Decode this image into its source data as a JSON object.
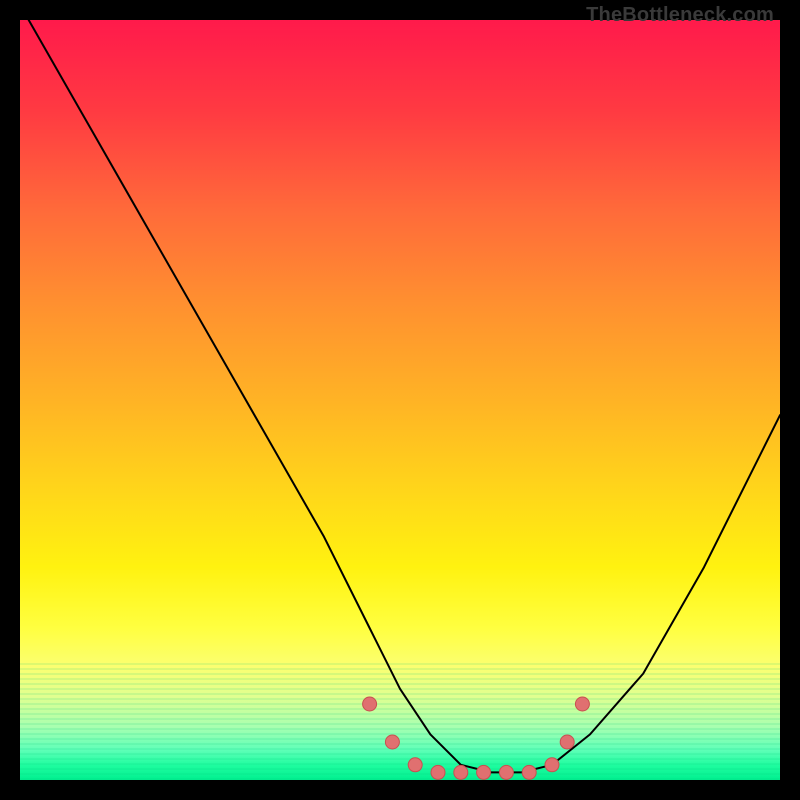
{
  "watermark": "TheBottleneck.com",
  "chart_data": {
    "type": "line",
    "title": "",
    "xlabel": "",
    "ylabel": "",
    "xlim": [
      0,
      100
    ],
    "ylim": [
      0,
      100
    ],
    "series": [
      {
        "name": "bottleneck-curve",
        "x": [
          0,
          8,
          16,
          24,
          32,
          40,
          46,
          50,
          54,
          58,
          62,
          66,
          70,
          75,
          82,
          90,
          98,
          100
        ],
        "values": [
          102,
          88,
          74,
          60,
          46,
          32,
          20,
          12,
          6,
          2,
          1,
          1,
          2,
          6,
          14,
          28,
          44,
          48
        ]
      }
    ],
    "markers": {
      "name": "trough-markers",
      "x": [
        46,
        49,
        52,
        55,
        58,
        61,
        64,
        67,
        70,
        72,
        74
      ],
      "values": [
        10,
        5,
        2,
        1,
        1,
        1,
        1,
        1,
        2,
        5,
        10
      ]
    },
    "colors": {
      "curve": "#000000",
      "marker_fill": "#e07070",
      "marker_stroke": "#c85050"
    }
  }
}
